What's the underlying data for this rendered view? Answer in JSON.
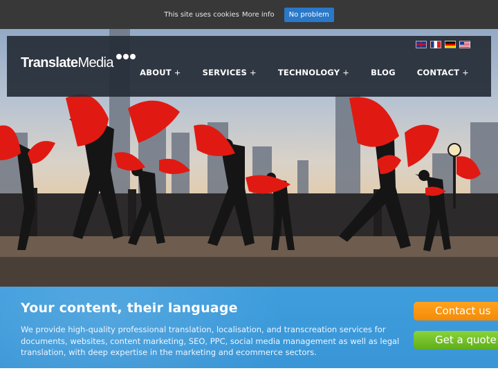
{
  "cookie_bar": {
    "message": "This site uses cookies",
    "more_info": "More info",
    "button": "No problem"
  },
  "header": {
    "logo_text_bold": "Translate",
    "logo_text_regular": "Media",
    "languages": [
      "English",
      "Français",
      "Deutsch",
      "English (US)"
    ],
    "nav": [
      {
        "label": "ABOUT",
        "has_submenu": true
      },
      {
        "label": "SERVICES",
        "has_submenu": true
      },
      {
        "label": "TECHNOLOGY",
        "has_submenu": true
      },
      {
        "label": "BLOG",
        "has_submenu": false
      },
      {
        "label": "CONTACT",
        "has_submenu": true
      }
    ],
    "submenu_marker": "+"
  },
  "hero": {
    "image": "people performing fan dance at sunset with city skyline"
  },
  "band": {
    "title": "Your content, their language",
    "text": "We provide high-quality professional translation, localisation, and transcreation services for documents, websites, content marketing, SEO, PPC, social media management as well as legal translation, with deep expertise in the marketing and ecommerce sectors.",
    "contact_button": "Contact us",
    "quote_button": "Get a quote"
  },
  "colors": {
    "cookie_bg": "#383838",
    "cookie_button": "#2a78c8",
    "header_bg": "#262d38",
    "band_bg": "#3a96d6",
    "contact_button": "#f48b07",
    "quote_button": "#5eae1b",
    "fan_red": "#e01a12"
  }
}
